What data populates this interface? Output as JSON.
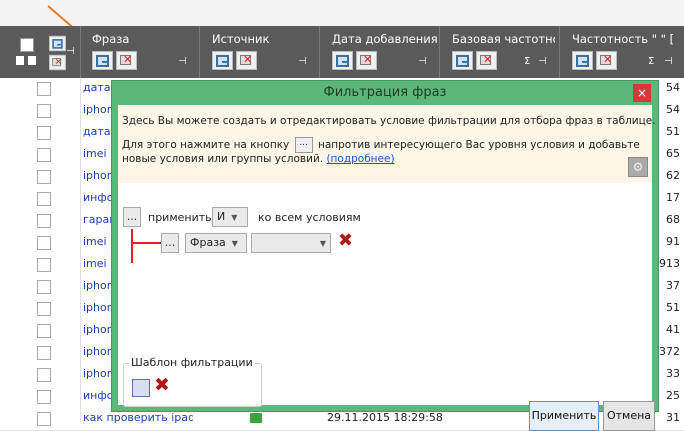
{
  "header": {
    "columns": [
      {
        "title": "Фраза"
      },
      {
        "title": "Источник"
      },
      {
        "title": "Дата добавления"
      },
      {
        "title": "Базовая частотно"
      },
      {
        "title": "Частотность \" \" ["
      }
    ]
  },
  "rows": [
    {
      "phrase": "дата",
      "num": "54"
    },
    {
      "phrase": "iphon",
      "num": "54"
    },
    {
      "phrase": "дата",
      "num": "51"
    },
    {
      "phrase": "imei",
      "num": "65"
    },
    {
      "phrase": "iphon",
      "num": "62"
    },
    {
      "phrase": "инфо",
      "num": "17"
    },
    {
      "phrase": "гарак",
      "num": "68"
    },
    {
      "phrase": "imei",
      "num": "91"
    },
    {
      "phrase": "imei",
      "num": "913"
    },
    {
      "phrase": "iphon",
      "num": "37"
    },
    {
      "phrase": "iphon",
      "num": "51"
    },
    {
      "phrase": "iphon",
      "num": "41"
    },
    {
      "phrase": "iphon",
      "num": "372"
    },
    {
      "phrase": "iphon",
      "num": "33"
    },
    {
      "phrase": "инфо",
      "num": "25"
    },
    {
      "phrase": "как проверить ipad",
      "num": "31",
      "date": "29.11.2015 18:29:58"
    }
  ],
  "dialog": {
    "title": "Фильтрация фраз",
    "close": "×",
    "info_line1": "Здесь Вы можете создать и отредактировать условие фильтрации для отбора фраз в таблице.",
    "info_line2_a": "Для этого нажмите на кнопку",
    "info_line2_btn": "...",
    "info_line2_b": "напротив интересующего Вас уровня условия и добавьте",
    "info_line3": "новые условия или группы условий.",
    "info_link": "(подробнее)",
    "root_btn": "...",
    "apply_word": "применить",
    "logic_op": "И",
    "to_all": "ко всем условиям",
    "cond_btn": "...",
    "cond_field": "Фраза",
    "cond_op": "",
    "template_label": "Шаблон фильтрации",
    "apply_button": "Применить",
    "cancel_button": "Отмена"
  },
  "icons": [
    "filter-icon",
    "clear-filter-icon",
    "pin-icon",
    "sigma-icon",
    "gear-icon",
    "save-icon",
    "delete-icon",
    "close-icon",
    "arrow-icon"
  ],
  "colors": {
    "dialog_green": "#5cb87a",
    "header_gray": "#5a5a5a",
    "link_blue": "#1a3cb4",
    "delete_red": "#b01818"
  }
}
